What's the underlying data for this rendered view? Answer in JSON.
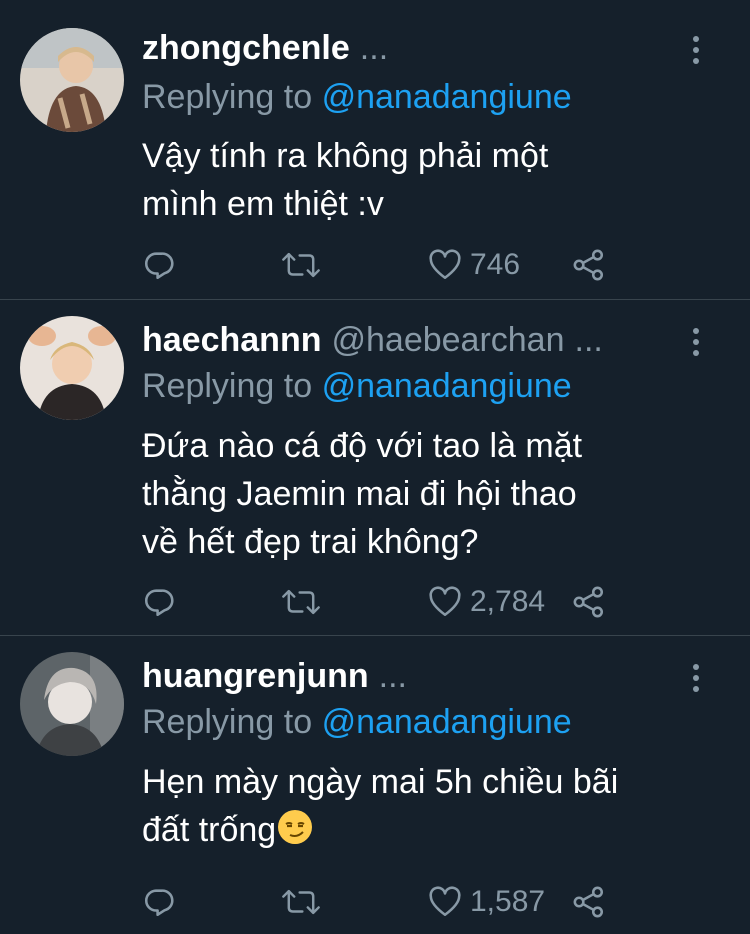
{
  "replies": [
    {
      "name": "zhongchenle",
      "handle": "",
      "ellipsis": "...",
      "replying_label": "Replying to",
      "mention": "@nanadangiune",
      "text_lines": [
        "Vậy tính ra không phải một",
        "mình em thiệt :v"
      ],
      "likes": "746",
      "avatar_colors": [
        "#c7a98a",
        "#6b4a3a",
        "#d9d2c9"
      ]
    },
    {
      "name": "haechannn",
      "handle": "@haebearchan",
      "ellipsis": "...",
      "replying_label": "Replying to",
      "mention": "@nanadangiune",
      "text_lines": [
        "Đứa nào cá độ với tao là mặt",
        "thằng Jaemin mai đi hội thao",
        "về hết đẹp trai không?"
      ],
      "likes": "2,784",
      "avatar_colors": [
        "#e9e2dc",
        "#2b2626",
        "#e7b693"
      ]
    },
    {
      "name": "huangrenjunn",
      "handle": "",
      "ellipsis": "...",
      "replying_label": "Replying to",
      "mention": "@nanadangiune",
      "text_lines": [
        "Hẹn mày ngày mai 5h chiều bãi",
        "đất trống"
      ],
      "emoji": "smirking-face",
      "likes": "1,587",
      "avatar_colors": [
        "#5d6468",
        "#e8e3df",
        "#b9b6b3"
      ]
    }
  ],
  "colors": {
    "background": "#15202b",
    "secondary_text": "#8899a6",
    "mention": "#1da1f2",
    "divider": "#38444d"
  },
  "icons": [
    "reply-icon",
    "retweet-icon",
    "like-icon",
    "share-icon",
    "more-icon"
  ]
}
